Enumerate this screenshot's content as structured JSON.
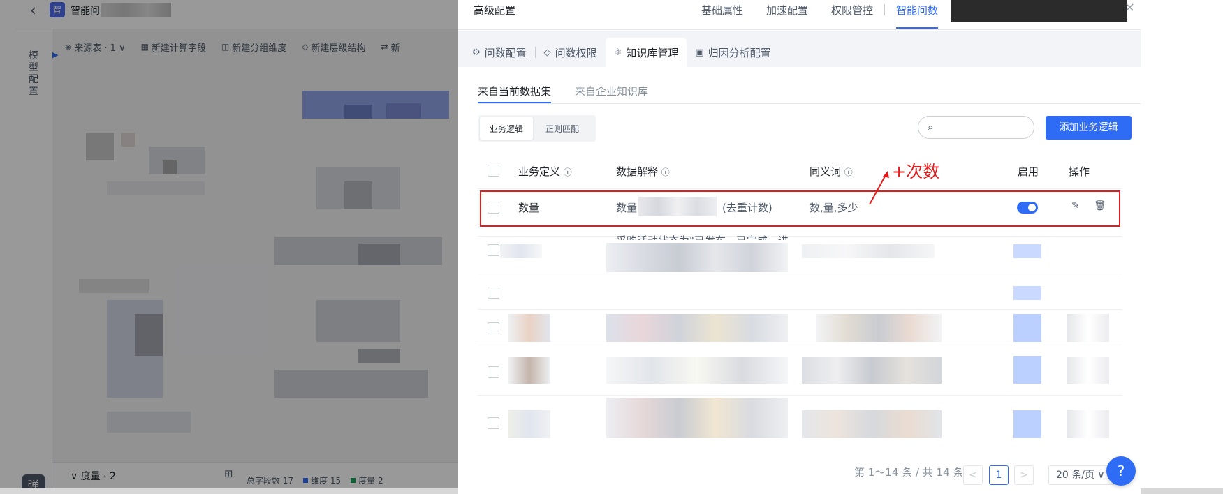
{
  "background_app": {
    "back_glyph": "‹",
    "logo_glyph": "智",
    "title": "智能问",
    "sidebar_label": "模型配置",
    "toolbar": [
      {
        "icon": "data-source-icon",
        "label": "来源表 · 1 ∨"
      },
      {
        "icon": "calc-field-icon",
        "label": "新建计算字段"
      },
      {
        "icon": "group-dimension-icon",
        "label": "新建分组维度"
      },
      {
        "icon": "hierarchy-icon",
        "label": "新建层级结构"
      },
      {
        "icon": "filter-icon",
        "label": "新"
      }
    ],
    "measure_group": "∨ 度量 · 2",
    "stats": {
      "total": "总字段数 17",
      "dimension": "维度 15",
      "measure": "度量 2"
    },
    "colors": {
      "dimension": "#2f6cf6",
      "measure": "#18a058"
    }
  },
  "drawer": {
    "title": "高级配置",
    "tabs": [
      {
        "label": "基础属性",
        "active": false
      },
      {
        "label": "加速配置",
        "active": false
      },
      {
        "label": "权限管控",
        "active": false
      },
      {
        "label": "智能问数",
        "active": true
      }
    ],
    "close_glyph": "×",
    "sub_tabs": [
      {
        "icon": "qa-config-icon",
        "glyph": "⚙",
        "label": "问数配置",
        "active": false
      },
      {
        "icon": "shield-icon",
        "glyph": "◇",
        "label": "问数权限",
        "active": false
      },
      {
        "icon": "knowledge-icon",
        "glyph": "⚛",
        "label": "知识库管理",
        "active": true
      },
      {
        "icon": "attribution-icon",
        "glyph": "▣",
        "label": "归因分析配置",
        "active": false
      }
    ],
    "source_tabs": [
      {
        "label": "来自当前数据集",
        "active": true
      },
      {
        "label": "来自企业知识库",
        "active": false
      }
    ],
    "segments": [
      {
        "label": "业务逻辑",
        "active": true
      },
      {
        "label": "正则匹配",
        "active": false
      }
    ],
    "search": {
      "value": "",
      "placeholder": ""
    },
    "add_button": "添加业务逻辑",
    "columns": {
      "definition": "业务定义",
      "explanation": "数据解释",
      "synonyms": "同义词",
      "enabled": "启用",
      "actions": "操作",
      "info_glyph": "ⓘ"
    },
    "rows": [
      {
        "definition": "数量",
        "explanation_prefix": "数量",
        "explanation_suffix": "(去重计数)",
        "synonyms": "数,量,多少",
        "enabled": true
      }
    ],
    "row2_cut_text": "采购活动状态为\"已发布、已完成、进",
    "annotation": {
      "text": "+次数",
      "color": "#e31c1c"
    },
    "pagination": {
      "summary": "第 1～14 条 / 共 14 条",
      "prev": "<",
      "current": "1",
      "next": ">",
      "page_size": "20 条/页 ∨"
    },
    "help_glyph": "?",
    "accent": "#2f6cf6"
  }
}
